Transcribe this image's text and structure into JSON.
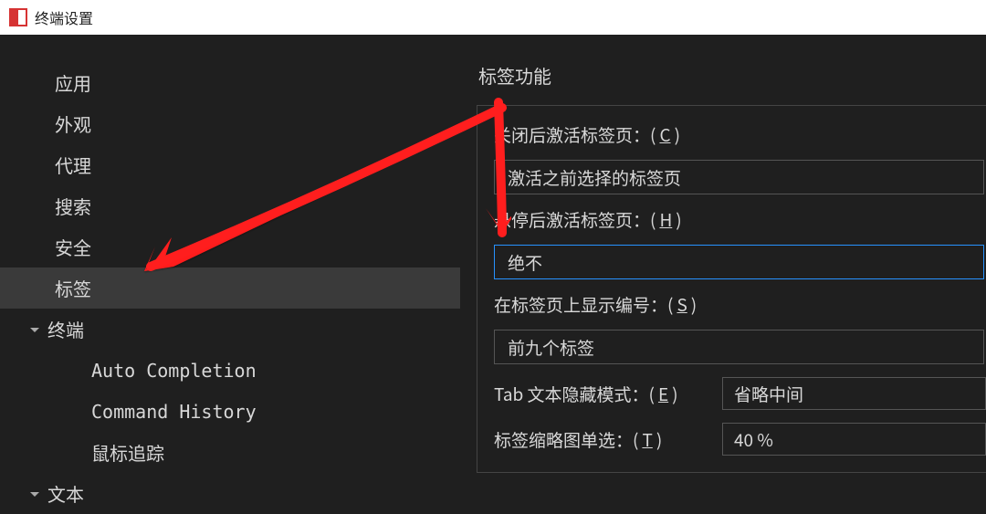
{
  "titlebar": {
    "title": "终端设置"
  },
  "sidebar": {
    "items": [
      {
        "label": "应用"
      },
      {
        "label": "外观"
      },
      {
        "label": "代理"
      },
      {
        "label": "搜索"
      },
      {
        "label": "安全"
      },
      {
        "label": "标签",
        "selected": true
      }
    ],
    "terminal_header": "终端",
    "terminal_sub": [
      {
        "label": "Auto Completion"
      },
      {
        "label": "Command History"
      },
      {
        "label": "鼠标追踪"
      }
    ],
    "text_header": "文本"
  },
  "content": {
    "section_title": "标签功能",
    "close_activate_label_pre": "关闭后激活标签页：(",
    "close_activate_mnemonic": "C",
    "close_activate_label_post": ")",
    "close_activate_value": "激活之前选择的标签页",
    "hover_activate_label_pre": "悬停后激活标签页：(",
    "hover_activate_mnemonic": "H",
    "hover_activate_label_post": ")",
    "hover_activate_value": "绝不",
    "show_number_label_pre": "在标签页上显示编号：(",
    "show_number_mnemonic": "S",
    "show_number_label_post": ")",
    "show_number_value": "前九个标签",
    "tab_hide_label_pre": "Tab 文本隐藏模式：(",
    "tab_hide_mnemonic": "E",
    "tab_hide_label_post": ")",
    "tab_hide_value": "省略中间",
    "thumb_label_pre": "标签缩略图单选：(",
    "thumb_mnemonic": "T",
    "thumb_label_post": ")",
    "thumb_value": "40 %"
  }
}
